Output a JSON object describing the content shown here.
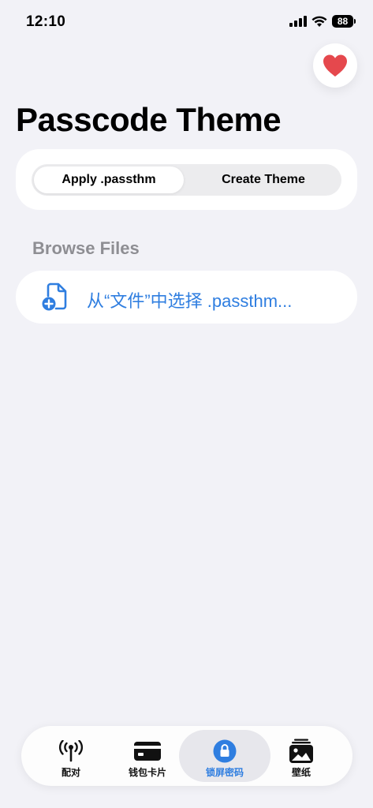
{
  "status_bar": {
    "time": "12:10",
    "battery": "88"
  },
  "header": {
    "title": "Passcode Theme",
    "favorite_icon": "heart-icon"
  },
  "segmented_control": {
    "options": [
      "Apply .passthm",
      "Create Theme"
    ],
    "selected": "Apply .passthm"
  },
  "browse": {
    "section_label": "Browse Files",
    "pick_file_label": "从“文件”中选择 .passthm...",
    "icon": "document-add-icon"
  },
  "tab_bar": {
    "items": [
      {
        "label": "配对",
        "icon": "antenna-icon"
      },
      {
        "label": "钱包卡片",
        "icon": "wallet-card-icon"
      },
      {
        "label": "锁屏密码",
        "icon": "lock-icon",
        "active": true
      },
      {
        "label": "壁纸",
        "icon": "wallpaper-icon"
      }
    ]
  },
  "colors": {
    "accent": "#2f7ee0",
    "heart": "#e5484d",
    "background": "#f2f2f7",
    "section_label": "#8e8e93"
  }
}
